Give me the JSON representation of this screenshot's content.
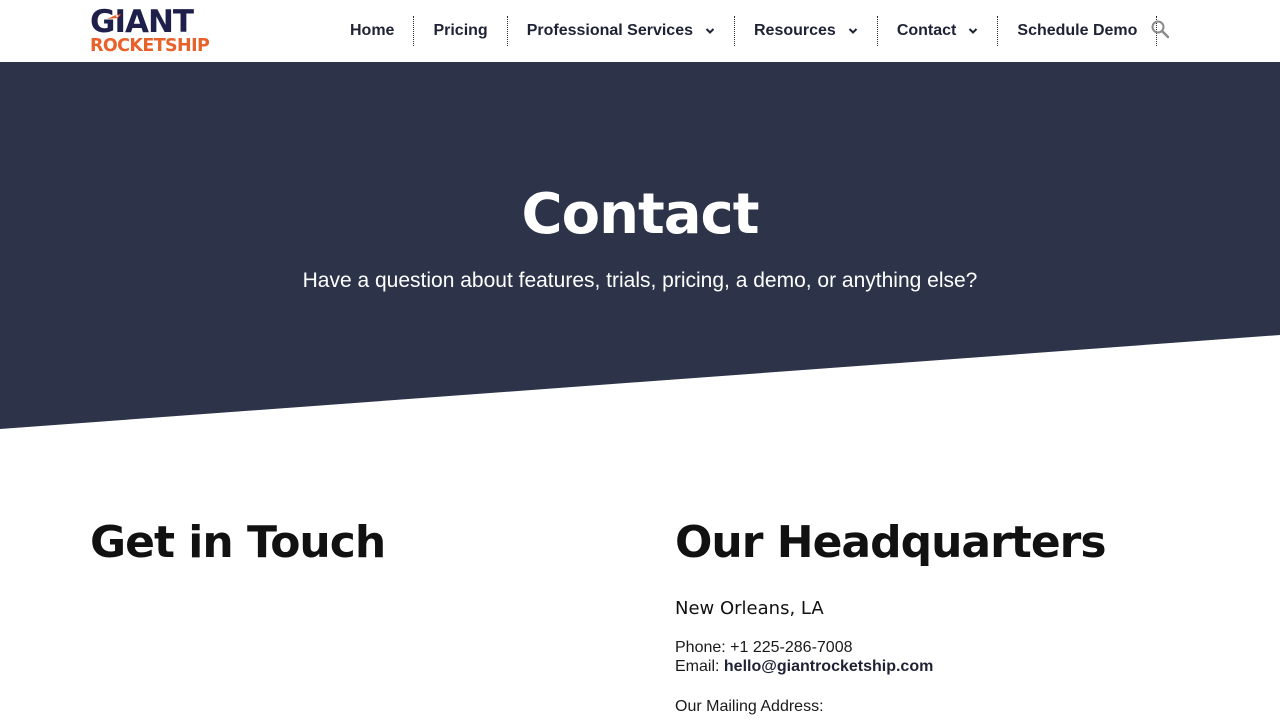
{
  "brand": {
    "logo_top": "GIANT",
    "logo_bottom": "ROCKETSHIP",
    "navy": "#1e1f4a",
    "orange": "#e9612a"
  },
  "nav": {
    "items": [
      {
        "label": "Home",
        "dropdown": false
      },
      {
        "label": "Pricing",
        "dropdown": false
      },
      {
        "label": "Professional Services",
        "dropdown": true
      },
      {
        "label": "Resources",
        "dropdown": true
      },
      {
        "label": "Contact",
        "dropdown": true
      },
      {
        "label": "Schedule Demo",
        "dropdown": false
      }
    ],
    "search_icon": "search-icon"
  },
  "hero": {
    "title": "Contact",
    "subtitle": "Have a question about features, trials, pricing, a demo, or anything else?",
    "bg_color": "#2d3449"
  },
  "get_in_touch": {
    "heading": "Get in Touch"
  },
  "headquarters": {
    "heading": "Our Headquarters",
    "city": "New Orleans, LA",
    "phone_label": "Phone:",
    "phone": "+1 225-286-7008",
    "email_label": "Email:",
    "email": "hello@giantrocketship.com",
    "mailing_label": "Our Mailing Address:"
  }
}
